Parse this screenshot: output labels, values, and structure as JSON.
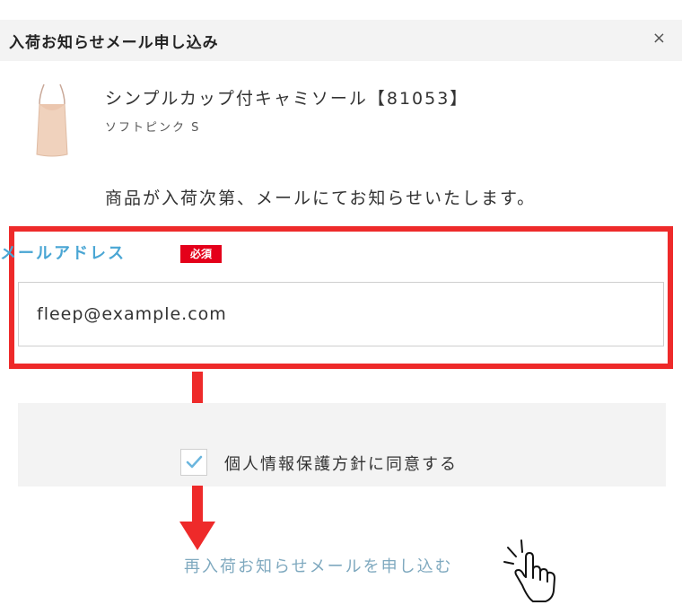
{
  "dialog": {
    "title": "入荷お知らせメール申し込み",
    "close_label": "×"
  },
  "product": {
    "name": "シンプルカップ付キャミソール【81053】",
    "variant": "ソフトピンク S"
  },
  "notice": "商品が入荷次第、メールにてお知らせいたします。",
  "email": {
    "label": "メールアドレス",
    "required_badge": "必須",
    "value": "fleep@example.com"
  },
  "agreement": {
    "label": "個人情報保護方針に同意する",
    "checked": true
  },
  "submit": {
    "label": "再入荷お知らせメールを申し込む"
  },
  "colors": {
    "accent_blue": "#4aa6d4",
    "annotation_red": "#ee2a2a",
    "required_red": "#e4001a",
    "submit_text": "#7fa9bf",
    "panel_gray": "#f3f3f3"
  }
}
